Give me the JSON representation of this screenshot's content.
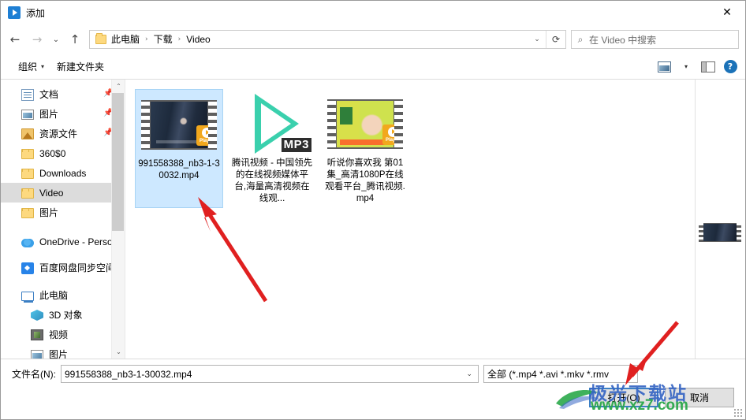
{
  "window": {
    "title": "添加",
    "app_icon": "play-icon",
    "close_label": "✕"
  },
  "nav": {
    "back_icon": "←",
    "forward_icon": "→",
    "recent_icon": "⌄",
    "up_icon": "↑",
    "breadcrumbs": [
      "此电脑",
      "下载",
      "Video"
    ],
    "crumb_sep": "›",
    "dropdown_icon": "⌄",
    "refresh_icon": "⟳",
    "search_placeholder": "在 Video 中搜索",
    "search_icon": "⌕"
  },
  "commandbar": {
    "organize_label": "组织",
    "organize_caret": "▾",
    "new_folder_label": "新建文件夹",
    "view_caret": "▾",
    "help_label": "?"
  },
  "sidebar": {
    "items": [
      {
        "label": "文档",
        "icon": "document-icon",
        "pinned": true,
        "indent": 1,
        "state": "normal"
      },
      {
        "label": "图片",
        "icon": "picture-icon",
        "pinned": true,
        "indent": 1,
        "state": "normal"
      },
      {
        "label": "资源文件",
        "icon": "resource-icon",
        "pinned": true,
        "indent": 1,
        "state": "normal"
      },
      {
        "label": "360$0",
        "icon": "folder-icon",
        "pinned": false,
        "indent": 1,
        "state": "normal"
      },
      {
        "label": "Downloads",
        "icon": "folder-icon",
        "pinned": false,
        "indent": 1,
        "state": "normal"
      },
      {
        "label": "Video",
        "icon": "folder-icon",
        "pinned": false,
        "indent": 1,
        "state": "selected"
      },
      {
        "label": "图片",
        "icon": "folder-icon",
        "pinned": false,
        "indent": 1,
        "state": "normal"
      },
      {
        "label": "OneDrive - Perso",
        "icon": "onedrive-icon",
        "pinned": false,
        "indent": 0,
        "state": "normal"
      },
      {
        "label": "百度网盘同步空间",
        "icon": "baidu-netdisk-icon",
        "pinned": false,
        "indent": 0,
        "state": "normal"
      },
      {
        "label": "此电脑",
        "icon": "this-pc-icon",
        "pinned": false,
        "indent": 0,
        "state": "normal"
      },
      {
        "label": "3D 对象",
        "icon": "3d-objects-icon",
        "pinned": false,
        "indent": 1,
        "state": "normal"
      },
      {
        "label": "视频",
        "icon": "video-icon",
        "pinned": false,
        "indent": 1,
        "state": "normal"
      },
      {
        "label": "图片",
        "icon": "picture-icon",
        "pinned": false,
        "indent": 1,
        "state": "normal"
      }
    ],
    "scroll_up_icon": "⌃",
    "scroll_down_icon": "⌄"
  },
  "files": [
    {
      "name": "991558388_nb3-1-30032.mp4",
      "thumb": "video-film-thumb-dark",
      "badge": "Player",
      "selected": true
    },
    {
      "name": "腾讯视频 - 中国领先的在线视频媒体平台,海量高清视频在线观...",
      "thumb": "mp3-play-thumb",
      "badge_text": "MP3",
      "selected": false
    },
    {
      "name": "听说你喜欢我 第01集_高清1080P在线观看平台_腾讯视频.mp4",
      "thumb": "video-film-thumb-yellow",
      "badge": "Player",
      "selected": false
    }
  ],
  "footer": {
    "filename_label": "文件名(N):",
    "filename_value": "991558388_nb3-1-30032.mp4",
    "filename_caret": "⌄",
    "filter_value": "全部 (*.mp4 *.avi *.mkv *.rmv",
    "filter_caret": "⌄",
    "open_button": "打开(O)",
    "cancel_button": "取消"
  },
  "watermark": {
    "line1": "极光下载站",
    "line2": "www.xz7.com"
  },
  "colors": {
    "accent": "#3b7fc4",
    "selection": "#cde8ff",
    "arrow": "#e02020",
    "mp3_green": "#3ad0ad",
    "badge_orange": "#f2a81d"
  }
}
